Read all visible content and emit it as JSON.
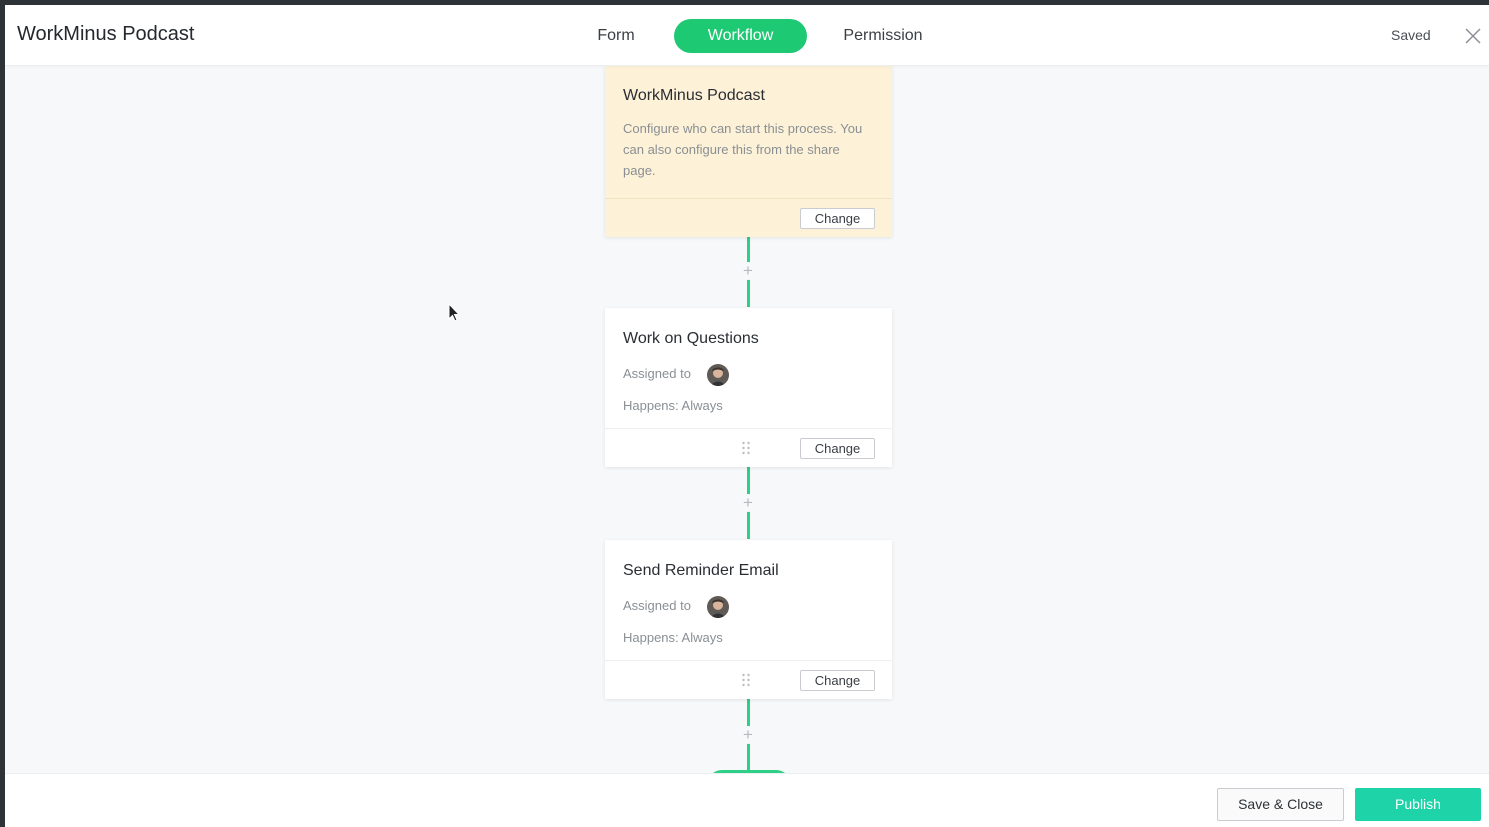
{
  "header": {
    "title": "WorkMinus Podcast",
    "tabs": [
      {
        "label": "Form"
      },
      {
        "label": "Workflow",
        "active": true
      },
      {
        "label": "Permission"
      }
    ],
    "status": "Saved",
    "close_icon": "close-icon"
  },
  "workflow": {
    "start": {
      "title": "WorkMinus Podcast",
      "description": "Configure who can start this process. You can also configure this from the share page.",
      "change_label": "Change"
    },
    "steps": [
      {
        "title": "Work on Questions",
        "assigned_label": "Assigned to",
        "happens": "Happens: Always",
        "change_label": "Change"
      },
      {
        "title": "Send Reminder Email",
        "assigned_label": "Assigned to",
        "happens": "Happens: Always",
        "change_label": "Change"
      }
    ],
    "add_icon": "plus-icon"
  },
  "footer": {
    "save_close_label": "Save & Close",
    "publish_label": "Publish"
  },
  "colors": {
    "accent_green": "#1ec974",
    "connector": "#2ecf86",
    "publish": "#1dd3a7",
    "start_card_bg": "#fdf1d7"
  }
}
